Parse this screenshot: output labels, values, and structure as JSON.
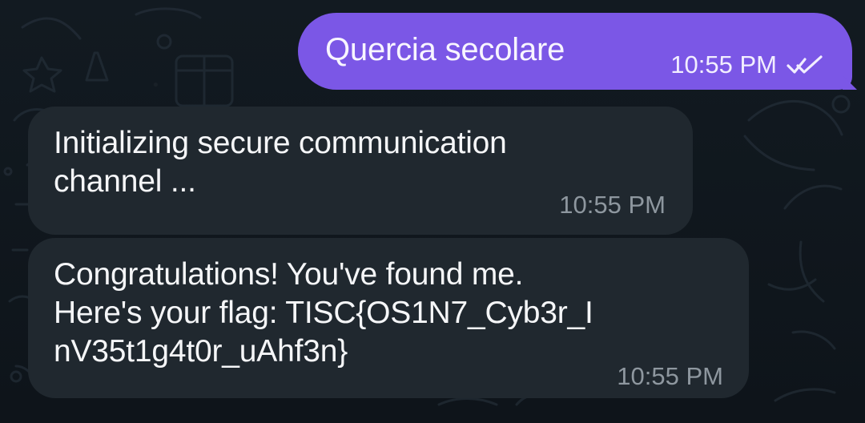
{
  "messages": [
    {
      "direction": "outgoing",
      "text": "Quercia secolare",
      "time": "10:55 PM",
      "status_icon": "double-check-icon"
    },
    {
      "direction": "incoming",
      "text": "Initializing secure communication\nchannel ...",
      "time": "10:55 PM"
    },
    {
      "direction": "incoming",
      "text": "Congratulations! You've found me.\nHere's your flag: TISC{OS1N7_Cyb3r_I\nnV35t1g4t0r_uAhf3n}",
      "time": "10:55 PM"
    }
  ],
  "colors": {
    "background": "#0f151b",
    "outgoing_bubble": "#7b57e6",
    "incoming_bubble": "#20282f",
    "incoming_meta": "#8e979f"
  }
}
